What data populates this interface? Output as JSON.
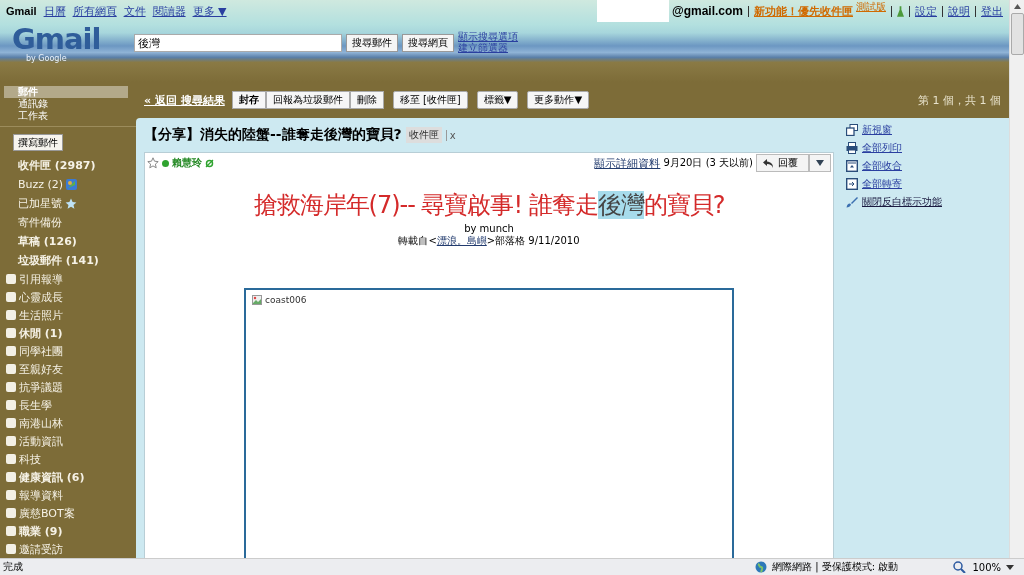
{
  "top_nav": {
    "brand": "Gmail",
    "links": [
      "日曆",
      "所有網頁",
      "文件",
      "閱讀器",
      "更多 ▼"
    ]
  },
  "account": {
    "email_suffix": "@gmail.com",
    "promo": "新功能！優先收件匣",
    "promo_badge": "測試版",
    "links": [
      "設定",
      "說明",
      "登出"
    ]
  },
  "logo": {
    "name": "Gmail",
    "byline": "by Google"
  },
  "search": {
    "value": "後灣",
    "buttons": [
      "搜尋郵件",
      "搜尋網頁"
    ],
    "links": [
      "顯示搜尋選項",
      "建立篩選器"
    ]
  },
  "sidebar": {
    "sections": [
      {
        "label": "郵件",
        "selected": true
      },
      {
        "label": "通訊錄",
        "selected": false
      },
      {
        "label": "工作表",
        "selected": false
      }
    ],
    "compose": "撰寫郵件",
    "folders": [
      {
        "label": "收件匣 (2987)",
        "unread": true,
        "kind": "plain"
      },
      {
        "label": "Buzz (2)",
        "unread": false,
        "kind": "buzz"
      },
      {
        "label": "已加星號",
        "unread": false,
        "kind": "starred"
      },
      {
        "label": "寄件備份",
        "unread": false,
        "kind": "plain"
      },
      {
        "label": "草稿 (126)",
        "unread": true,
        "kind": "plain"
      },
      {
        "label": "垃圾郵件 (141)",
        "unread": true,
        "kind": "plain"
      }
    ],
    "labels": [
      {
        "label": "引用報導",
        "unread": false
      },
      {
        "label": "心靈成長",
        "unread": false
      },
      {
        "label": "生活照片",
        "unread": false
      },
      {
        "label": "休閒 (1)",
        "unread": true
      },
      {
        "label": "同學社團",
        "unread": false
      },
      {
        "label": "至親好友",
        "unread": false
      },
      {
        "label": "抗爭議題",
        "unread": false
      },
      {
        "label": "長生學",
        "unread": false
      },
      {
        "label": "南港山林",
        "unread": false
      },
      {
        "label": "活動資訊",
        "unread": false
      },
      {
        "label": "科技",
        "unread": false
      },
      {
        "label": "健康資訊 (6)",
        "unread": true
      },
      {
        "label": "報導資料",
        "unread": false
      },
      {
        "label": "廣慈BOT案",
        "unread": false
      },
      {
        "label": "職業 (9)",
        "unread": true
      },
      {
        "label": "邀請受訪",
        "unread": false
      }
    ]
  },
  "toolbar": {
    "back": "« 返回 搜尋結果",
    "group": [
      {
        "label": "封存",
        "bold": true
      },
      {
        "label": "回報為垃圾郵件",
        "bold": false
      },
      {
        "label": "刪除",
        "bold": false
      }
    ],
    "buttons": [
      "移至 [收件匣]",
      "標籤▼",
      "更多動作▼"
    ],
    "pager": "第 1 個，共 1 個"
  },
  "conversation": {
    "subject": "【分享】消失的陸蟹--誰奪走後灣的寶貝?",
    "label_chip": "收件匣",
    "chip_close": "x",
    "message": {
      "starred": false,
      "online": true,
      "sender": "賴慧玲",
      "details_link": "顯示詳細資料",
      "date": "9月20日 (3 天以前)",
      "reply": "回覆",
      "heading": [
        {
          "text": "搶救海岸年(7)-- 尋寶啟事! 誰奪走",
          "highlighted": false
        },
        {
          "text": "後灣",
          "highlighted": true
        },
        {
          "text": "的寶貝?",
          "highlighted": false
        }
      ],
      "byline": "by munch",
      "source_prefix": "轉載自<",
      "source_link": "漂浪。島嶼",
      "source_suffix": ">部落格 9/11/2010",
      "image_alt": "coast006"
    }
  },
  "actions": [
    {
      "label": "新視窗",
      "kind": "window",
      "bold": false
    },
    {
      "label": "全部列印",
      "kind": "print",
      "bold": false
    },
    {
      "label": "全部收合",
      "kind": "collapse",
      "bold": false
    },
    {
      "label": "全部轉寄",
      "kind": "forward",
      "bold": false
    },
    {
      "label": "關閉反白標示功能",
      "kind": "brush",
      "bold": true
    }
  ],
  "status_bar": {
    "left": "完成",
    "zone": "網際網路 | 受保護模式: 啟動",
    "zoom": "100%"
  }
}
